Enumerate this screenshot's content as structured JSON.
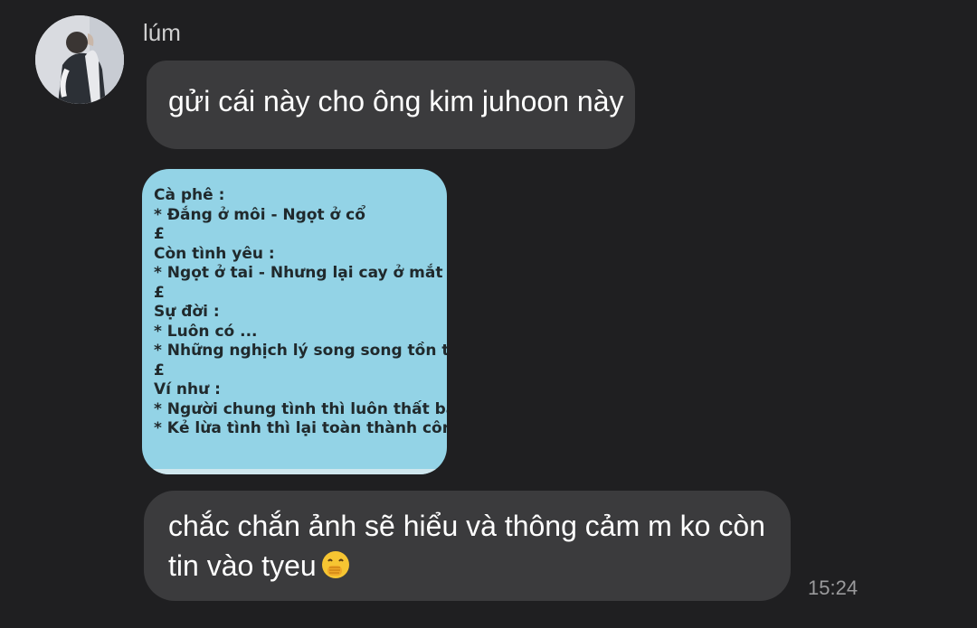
{
  "sender": {
    "name": "lúm"
  },
  "messages": [
    {
      "text": "gửi cái này cho ông kim juhoon này"
    },
    {
      "type": "image",
      "lines": [
        "Cà phê :",
        "* Đắng ở môi - Ngọt ở cổ",
        "£",
        "Còn tình yêu :",
        "* Ngọt ở tai - Nhưng lại cay ở mắt",
        "£",
        "Sự đời :",
        "* Luôn có ...",
        "* Những nghịch lý song song tồn tại",
        "£",
        "Ví như :",
        "* Người chung tình thì luôn thất bại",
        "* Kẻ lừa tình thì lại toàn thành công"
      ]
    },
    {
      "line1": "chắc chắn ảnh sẽ hiểu và thông cảm m ko còn",
      "line2": "tin vào tyeu",
      "emoji": "face-with-hand-over-mouth-icon"
    }
  ],
  "timestamp": "15:24",
  "colors": {
    "background": "#1f1f21",
    "bubble": "#3b3b3d",
    "photo_background": "#93d3e6"
  }
}
